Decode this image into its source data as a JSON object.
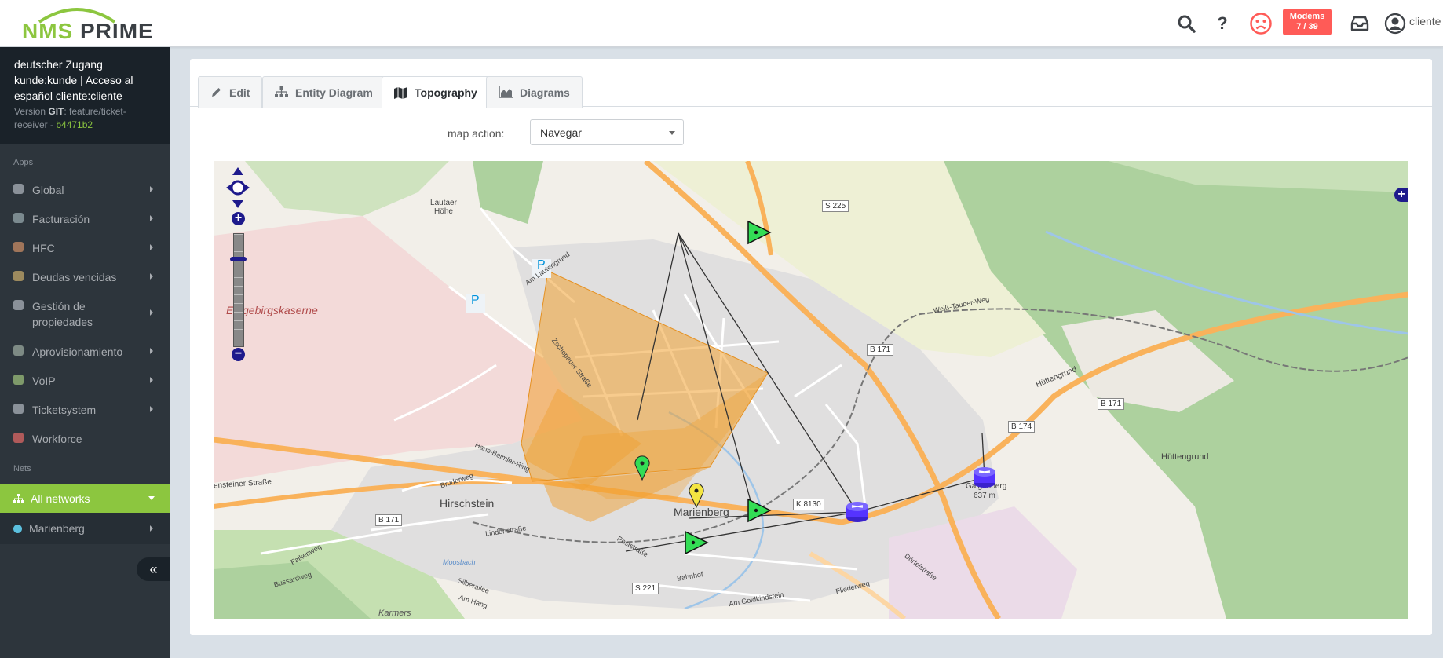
{
  "header": {
    "logo_nms": "NMS",
    "logo_prime": "PRIME",
    "icons": [
      "search-icon",
      "help-icon",
      "sad-face-icon",
      "inbox-icon",
      "user-circle-icon"
    ],
    "modems_label": "Modems",
    "modems_count": "7 / 39",
    "user": "cliente",
    "sad_color": "#ff5b57"
  },
  "sidebar": {
    "profile": {
      "line1": "deutscher Zugang",
      "line2": "kunde:kunde | Acceso al",
      "line3": "español cliente:cliente",
      "version_prefix": "Version",
      "git": "GIT",
      "branch": ": feature/ticket-receiver - ",
      "hash": "b4471b2"
    },
    "apps_heading": "Apps",
    "apps": [
      {
        "label": "Global",
        "icon": "globe-icon",
        "color": "#8a9199"
      },
      {
        "label": "Facturación",
        "icon": "billing-icon",
        "color": "#7b8a8f"
      },
      {
        "label": "HFC",
        "icon": "hfc-icon",
        "color": "#a0755a"
      },
      {
        "label": "Deudas vencidas",
        "icon": "debt-icon",
        "color": "#9c8a5e"
      },
      {
        "label": "Gestión de propiedades",
        "icon": "property-icon",
        "color": "#8a9199"
      },
      {
        "label": "Aprovisionamiento",
        "icon": "provisioning-icon",
        "color": "#7d8a84"
      },
      {
        "label": "VoIP",
        "icon": "voip-icon",
        "color": "#7e9a6a"
      },
      {
        "label": "Ticketsystem",
        "icon": "ticket-icon",
        "color": "#8a9199"
      },
      {
        "label": "Workforce",
        "icon": "workforce-icon",
        "color": "#b05a5a"
      }
    ],
    "nets_heading": "Nets",
    "all_networks": "All networks",
    "net_item": "Marienberg",
    "collapse": "«",
    "accent": "#8cc63f"
  },
  "tabs": [
    {
      "label": "Edit",
      "icon": "pencil-icon"
    },
    {
      "label": "Entity Diagram",
      "icon": "sitemap-icon"
    },
    {
      "label": "Topography",
      "icon": "map-icon",
      "active": true
    },
    {
      "label": "Diagrams",
      "icon": "area-chart-icon"
    }
  ],
  "map_action": {
    "label": "map action:",
    "selected": "Navegar"
  },
  "map": {
    "labels": {
      "erzgebirgskaserne": "Erzgebirgskaserne",
      "lautaer_hohe": "Lautaer Höhe",
      "hirschstein": "Hirschstein",
      "marienberg": "Marienberg",
      "galgenberg": "Galgenberg",
      "galgenberg_ele": "637 m",
      "huttengrund": "Hüttengrund",
      "huttengrund2": "Hüttengrund",
      "karmers": "Karmers",
      "bahnhof": "Bahnhof",
      "weiss_tauber": "Weiß-Tauber-Weg",
      "steiner": "ensteiner Straße",
      "zschopauer": "Zschopauer Straße",
      "am_lautengrund": "Am Lautengrund",
      "postrasse": "Poststraße",
      "hans_beimler": "Hans-Beimler-Ring",
      "bruderweg": "Bruderweg",
      "lindenstrasse": "Lindenstraße",
      "moosbach": "Moosbach",
      "fliederweg": "Fliederweg",
      "am_goldkindstein": "Am Goldkindstein",
      "dorfelstrasse": "Dörfelstraße",
      "buesardweg": "Bussardweg",
      "falkenweg": "Falkenweg",
      "silberallee": "Silberallee",
      "am_hang": "Am Hang",
      "parking": "P"
    },
    "shields": {
      "s225": "S 225",
      "b171a": "B 171",
      "b171b": "B 171",
      "b171c": "B 171",
      "b174": "B 174",
      "k8130": "K 8130",
      "s221": "S 221"
    },
    "zoom_in": "+",
    "zoom_out": "−",
    "layer_switch": "+",
    "colors": {
      "coverage": "#f0a030",
      "forest": "#add19e",
      "residential": "#e0dfdf",
      "military": "#f3d6d6",
      "marker_green": "#33dd55",
      "marker_yellow": "#f4e542",
      "node_blue": "#5533ff"
    }
  }
}
